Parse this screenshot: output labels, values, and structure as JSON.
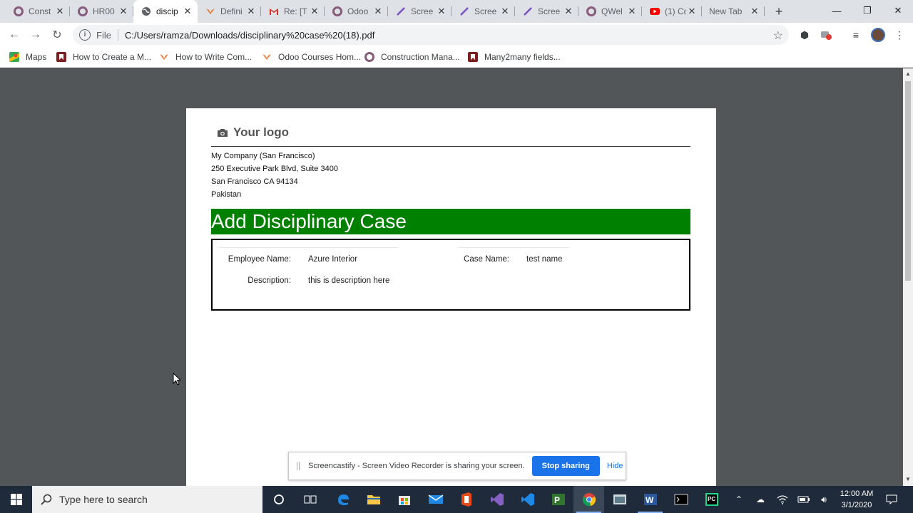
{
  "browser": {
    "tabs": [
      {
        "label": "Const",
        "icon": "odoo-icon"
      },
      {
        "label": "HR00",
        "icon": "odoo-icon"
      },
      {
        "label": "discip",
        "icon": "globe-icon"
      },
      {
        "label": "Defini",
        "icon": "bird-icon"
      },
      {
        "label": "Re: [T",
        "icon": "gmail-icon"
      },
      {
        "label": "Odoo",
        "icon": "odoo-icon"
      },
      {
        "label": "Scree",
        "icon": "pen-icon"
      },
      {
        "label": "Scree",
        "icon": "pen-icon"
      },
      {
        "label": "Scree",
        "icon": "pen-icon"
      },
      {
        "label": "QWel",
        "icon": "odoo-icon"
      },
      {
        "label": "(1) Co",
        "icon": "youtube-icon"
      },
      {
        "label": "New Tab",
        "icon": ""
      }
    ],
    "address": {
      "scheme_label": "File",
      "url": "C:/Users/ramza/Downloads/disciplinary%20case%20(18).pdf"
    },
    "bookmarks": [
      {
        "label": "Maps",
        "icon": "maps-icon"
      },
      {
        "label": "How to Create a M...",
        "icon": "bookmark-red-icon"
      },
      {
        "label": "How to Write Com...",
        "icon": "bird-icon"
      },
      {
        "label": "Odoo Courses Hom...",
        "icon": "bird-icon"
      },
      {
        "label": "Construction Mana...",
        "icon": "odoo-icon"
      },
      {
        "label": "Many2many fields...",
        "icon": "bookmark-red-icon"
      }
    ]
  },
  "document": {
    "logo_text": "Your logo",
    "company_address": [
      "My Company (San Francisco)",
      "250 Executive Park Blvd, Suite 3400",
      "San Francisco CA 94134",
      "Pakistan"
    ],
    "heading": "Add Disciplinary Case",
    "fields": {
      "employee_name_label": "Employee Name:",
      "employee_name_value": "Azure Interior",
      "case_name_label": "Case Name:",
      "case_name_value": "test name",
      "description_label": "Description:",
      "description_value": "this is description here"
    }
  },
  "sharing_bar": {
    "message": "Screencastify - Screen Video Recorder is sharing your screen.",
    "stop_label": "Stop sharing",
    "hide_label": "Hide"
  },
  "taskbar": {
    "search_placeholder": "Type here to search",
    "time": "12:00 AM",
    "date": "3/1/2020"
  },
  "colors": {
    "heading_bg": "#008000",
    "odoo_purple": "#875a7b",
    "stop_button": "#1a73e8",
    "taskbar_bg": "#1f2b3a"
  }
}
